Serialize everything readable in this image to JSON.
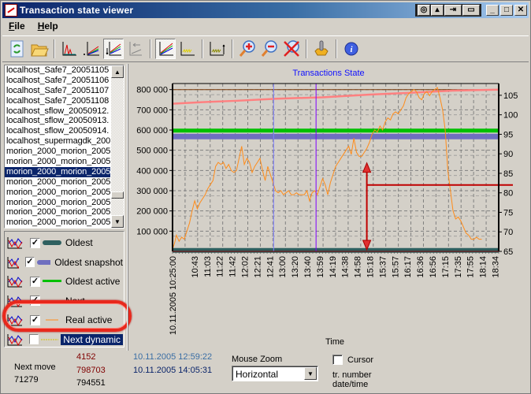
{
  "window": {
    "title": "Transaction state viewer",
    "controls": [
      "minimize",
      "maximize",
      "close"
    ]
  },
  "menu": [
    {
      "label": "File",
      "accel": "F"
    },
    {
      "label": "Help",
      "accel": "H"
    }
  ],
  "toolbar": [
    {
      "name": "refresh-file",
      "pressed": false
    },
    {
      "name": "open-folder",
      "pressed": false
    },
    {
      "sep": true
    },
    {
      "name": "chart-peaks",
      "pressed": false
    },
    {
      "name": "chart-lines-origin",
      "pressed": false
    },
    {
      "name": "chart-lines-down",
      "pressed": true
    },
    {
      "name": "chart-lines-back",
      "pressed": false
    },
    {
      "sep": true
    },
    {
      "name": "chart-multiline",
      "pressed": true
    },
    {
      "name": "chart-yellow",
      "pressed": false
    },
    {
      "sep": true
    },
    {
      "name": "chart-olive",
      "pressed": false
    },
    {
      "sep": true
    },
    {
      "name": "zoom-in",
      "pressed": false
    },
    {
      "name": "zoom-out",
      "pressed": false
    },
    {
      "name": "zoom-reset",
      "pressed": false
    },
    {
      "sep": true
    },
    {
      "name": "settings",
      "pressed": false
    },
    {
      "sep": true
    },
    {
      "name": "info",
      "pressed": false
    }
  ],
  "files": {
    "items": [
      "localhost_Safe7_20051105",
      "localhost_Safe7_20051106",
      "localhost_Safe7_20051107",
      "localhost_Safe7_20051108",
      "localhost_sflow_20050912.",
      "localhost_sflow_20050913.",
      "localhost_sflow_20050914.",
      "localhost_supermagdk_200",
      "morion_2000_morion_2005",
      "morion_2000_morion_2005",
      "morion_2000_morion_2005",
      "morion_2000_morion_2005",
      "morion_2000_morion_2005",
      "morion_2000_morion_2005",
      "morion_2000_morion_2005",
      "morion_2000_morion_2005"
    ],
    "selected_index": 10
  },
  "legend": [
    {
      "label": "Oldest",
      "checked": true,
      "color": "#2f6060",
      "style": "thick"
    },
    {
      "label": "Oldest snapshot",
      "checked": true,
      "color": "#6f6fbf",
      "style": "thick"
    },
    {
      "label": "Oldest active",
      "checked": true,
      "color": "#00c000",
      "style": "medium"
    },
    {
      "label": "Next",
      "checked": true,
      "color": "#7a3a0a",
      "style": "thin"
    },
    {
      "label": "Real active",
      "checked": true,
      "color": "#ff8c1a",
      "style": "thin",
      "highlighted": true
    },
    {
      "label": "Next dynamic",
      "checked": false,
      "color": "#d8c000",
      "style": "dotted",
      "selected": true
    }
  ],
  "status": {
    "next_move_label": "Next move",
    "next_move_value": "71279",
    "num1": "4152",
    "num2": "798703",
    "num3": "794551",
    "date1": "10.11.2005 12:59:22",
    "date2": "10.11.2005 14:05:31",
    "mouse_zoom_label": "Mouse Zoom",
    "mouse_zoom_value": "Horizontal",
    "cursor_label": "Cursor",
    "cursor_checked": false,
    "tr_number_label": "tr. number",
    "datetime_label": "date/time"
  },
  "chart_data": {
    "type": "line",
    "title": "Transactions State",
    "xlabel": "Time",
    "ylabel": "",
    "x_first_label": "10.11.2005 10:25:00",
    "x_ticks": [
      "10:43",
      "11:03",
      "11:22",
      "11:42",
      "12:02",
      "12:21",
      "12:41",
      "13:00",
      "13:20",
      "13:40",
      "13:59",
      "14:19",
      "14:38",
      "14:58",
      "15:18",
      "15:37",
      "15:57",
      "16:17",
      "16:36",
      "16:56",
      "17:15",
      "17:35",
      "17:55",
      "18:14",
      "18:34"
    ],
    "y_ticks": [
      "100 000",
      "200 000",
      "300 000",
      "400 000",
      "500 000",
      "600 000",
      "700 000",
      "800 000"
    ],
    "ylim": [
      0,
      830000
    ],
    "y2_ticks": [
      "65",
      "70",
      "75",
      "80",
      "85",
      "90",
      "95",
      "100",
      "105"
    ],
    "y2lim": [
      65,
      107
    ],
    "grid": true,
    "x_range_minutes": [
      0,
      500
    ],
    "vertical_markers": [
      {
        "time": "13:00",
        "color": "#8080ff"
      },
      {
        "time": "14:05",
        "color": "#8000ff"
      }
    ],
    "cursor": {
      "time": "15:18",
      "y2": 82
    },
    "series": [
      {
        "name": "Oldest",
        "color": "#2f6060",
        "x": [
          0,
          500
        ],
        "values": [
          5000,
          5000
        ]
      },
      {
        "name": "Oldest snapshot",
        "color": "#6f6fbf",
        "x": [
          0,
          500
        ],
        "values": [
          568000,
          568000
        ]
      },
      {
        "name": "Oldest active",
        "color": "#00c000",
        "x": [
          0,
          500
        ],
        "values": [
          597000,
          597000
        ]
      },
      {
        "name": "Next",
        "color": "#7a3a0a",
        "x": [
          0,
          500
        ],
        "values": [
          800000,
          800000
        ]
      },
      {
        "name": "Next dynamic (pink)",
        "color": "#ff8080",
        "x": [
          0,
          40,
          100,
          160,
          230,
          300,
          370,
          430,
          500
        ],
        "values": [
          730000,
          737000,
          745000,
          755000,
          762000,
          775000,
          785000,
          795000,
          800000
        ]
      },
      {
        "name": "Real active",
        "color": "#ff8c1a",
        "x": [
          0,
          3,
          6,
          10,
          14,
          18,
          22,
          26,
          30,
          34,
          38,
          42,
          46,
          50,
          54,
          58,
          62,
          66,
          70,
          74,
          78,
          82,
          86,
          90,
          94,
          98,
          102,
          106,
          110,
          114,
          118,
          122,
          126,
          130,
          134,
          138,
          142,
          146,
          150,
          154,
          158,
          162,
          166,
          170,
          174,
          178,
          182,
          186,
          190,
          194,
          198,
          202,
          206,
          210,
          214,
          218,
          222,
          226,
          230,
          234,
          238,
          242,
          246,
          250,
          254,
          258,
          262,
          266,
          270,
          274,
          278,
          282,
          286,
          290,
          294,
          298,
          302,
          306,
          310,
          314,
          318,
          322,
          326,
          330,
          334,
          338,
          342,
          346,
          350,
          354,
          358,
          362,
          366,
          370,
          374,
          378,
          382,
          386,
          390,
          394,
          398,
          402,
          406,
          410,
          414,
          418,
          422,
          426,
          430,
          434,
          438,
          442,
          446,
          450,
          454,
          458,
          462,
          466,
          470,
          474,
          478,
          482,
          486,
          490,
          494,
          498
        ],
        "values": [
          10000,
          40000,
          80000,
          50000,
          70000,
          60000,
          100000,
          140000,
          200000,
          250000,
          210000,
          240000,
          260000,
          280000,
          310000,
          330000,
          350000,
          420000,
          440000,
          430000,
          440000,
          410000,
          430000,
          400000,
          390000,
          400000,
          460000,
          520000,
          430000,
          460000,
          440000,
          390000,
          420000,
          440000,
          460000,
          400000,
          350000,
          420000,
          380000,
          340000,
          300000,
          290000,
          300000,
          280000,
          290000,
          300000,
          280000,
          280000,
          290000,
          280000,
          280000,
          280000,
          300000,
          250000,
          290000,
          300000,
          280000,
          320000,
          360000,
          330000,
          280000,
          340000,
          380000,
          420000,
          440000,
          460000,
          480000,
          500000,
          520000,
          480000,
          560000,
          490000,
          470000,
          470000,
          490000,
          510000,
          540000,
          580000,
          600000,
          590000,
          620000,
          600000,
          640000,
          660000,
          650000,
          680000,
          690000,
          680000,
          700000,
          720000,
          760000,
          780000,
          790000,
          800000,
          790000,
          760000,
          750000,
          780000,
          790000,
          770000,
          790000,
          800000,
          810000,
          760000,
          700000,
          600000,
          400000,
          300000,
          200000,
          160000,
          170000,
          150000,
          120000,
          90000,
          80000,
          60000,
          60000,
          70000,
          60000,
          60000
        ]
      }
    ]
  }
}
